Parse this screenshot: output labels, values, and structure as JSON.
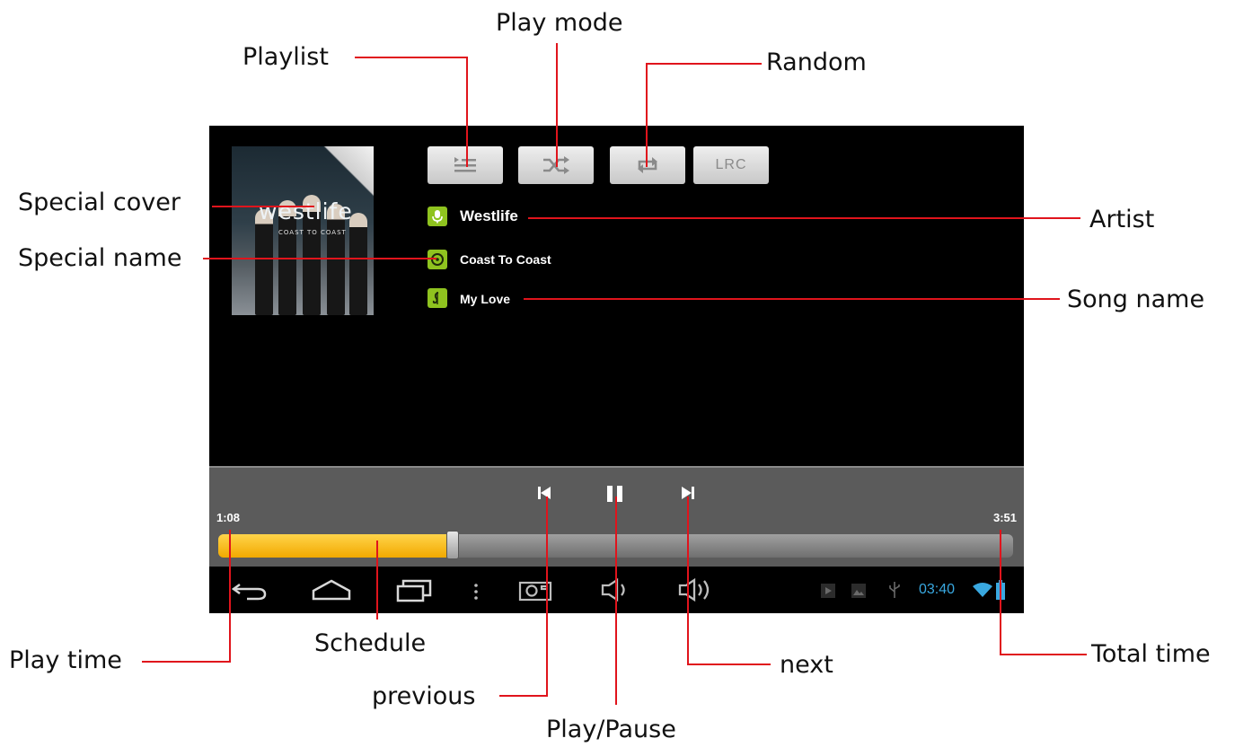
{
  "annotations": {
    "playlist": "Playlist",
    "play_mode": "Play mode",
    "random": "Random",
    "special_cover": "Special cover",
    "special_name": "Special name",
    "artist": "Artist",
    "song_name": "Song name",
    "play_time": "Play time",
    "schedule": "Schedule",
    "previous": "previous",
    "play_pause": "Play/Pause",
    "next": "next",
    "total_time": "Total time"
  },
  "toolbar": {
    "playlist_icon": "playlist-icon",
    "shuffle_icon": "shuffle-icon",
    "repeat_icon": "repeat-icon",
    "lrc_label": "LRC"
  },
  "cover": {
    "title": "westlife",
    "subtitle": "COAST TO COAST"
  },
  "track_info": {
    "artist": "Westlife",
    "album": "Coast To Coast",
    "song": "My Love",
    "artist_icon": "microphone-icon",
    "album_icon": "disc-icon",
    "song_icon": "music-note-icon"
  },
  "playback": {
    "elapsed": "1:08",
    "total": "3:51",
    "progress": 0.295,
    "state": "playing",
    "previous_icon": "previous-icon",
    "pause_icon": "pause-icon",
    "next_icon": "next-icon"
  },
  "system_bar": {
    "clock": "03:40",
    "icons": [
      "back-icon",
      "home-icon",
      "recent-apps-icon",
      "menu-icon",
      "screenshot-icon",
      "volume-down-icon",
      "volume-up-icon",
      "media-notification-icon",
      "image-notification-icon",
      "usb-icon",
      "wifi-icon",
      "battery-icon"
    ]
  },
  "colors": {
    "leader_line": "#e0141c",
    "progress_fill": "#f2a900",
    "badge_green": "#8fc31f",
    "clock_blue": "#39a8e0"
  }
}
